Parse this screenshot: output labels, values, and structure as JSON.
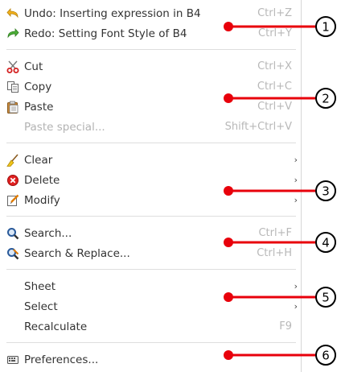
{
  "menu": {
    "items": [
      {
        "label": "Undo: Inserting expression in B4",
        "shortcut": "Ctrl+Z",
        "icon": "undo-icon"
      },
      {
        "label": "Redo: Setting Font Style of B4",
        "shortcut": "Ctrl+Y",
        "icon": "redo-icon"
      },
      {
        "label": "Cut",
        "shortcut": "Ctrl+X",
        "icon": "scissors-icon"
      },
      {
        "label": "Copy",
        "shortcut": "Ctrl+C",
        "icon": "copy-icon"
      },
      {
        "label": "Paste",
        "shortcut": "Ctrl+V",
        "icon": "paste-icon"
      },
      {
        "label": "Paste special...",
        "shortcut": "Shift+Ctrl+V",
        "disabled": true
      },
      {
        "label": "Clear",
        "submenu_arrow": "›",
        "icon": "broom-icon"
      },
      {
        "label": "Delete",
        "submenu_arrow": "›",
        "icon": "delete-icon"
      },
      {
        "label": "Modify",
        "submenu_arrow": "›",
        "icon": "edit-icon"
      },
      {
        "label": "Search...",
        "shortcut": "Ctrl+F",
        "icon": "search-icon"
      },
      {
        "label": "Search & Replace...",
        "shortcut": "Ctrl+H",
        "icon": "search-replace-icon"
      },
      {
        "label": "Sheet",
        "submenu_arrow": "›"
      },
      {
        "label": "Select",
        "submenu_arrow": "›"
      },
      {
        "label": "Recalculate",
        "shortcut": "F9"
      },
      {
        "label": "Preferences...",
        "icon": "preferences-icon"
      }
    ]
  },
  "callouts": [
    "1",
    "2",
    "3",
    "4",
    "5",
    "6"
  ],
  "colors": {
    "callout_red": "#e8000b",
    "disabled_text": "#b3b3b3",
    "shortcut_text": "#b8b8b8",
    "text": "#333333"
  }
}
